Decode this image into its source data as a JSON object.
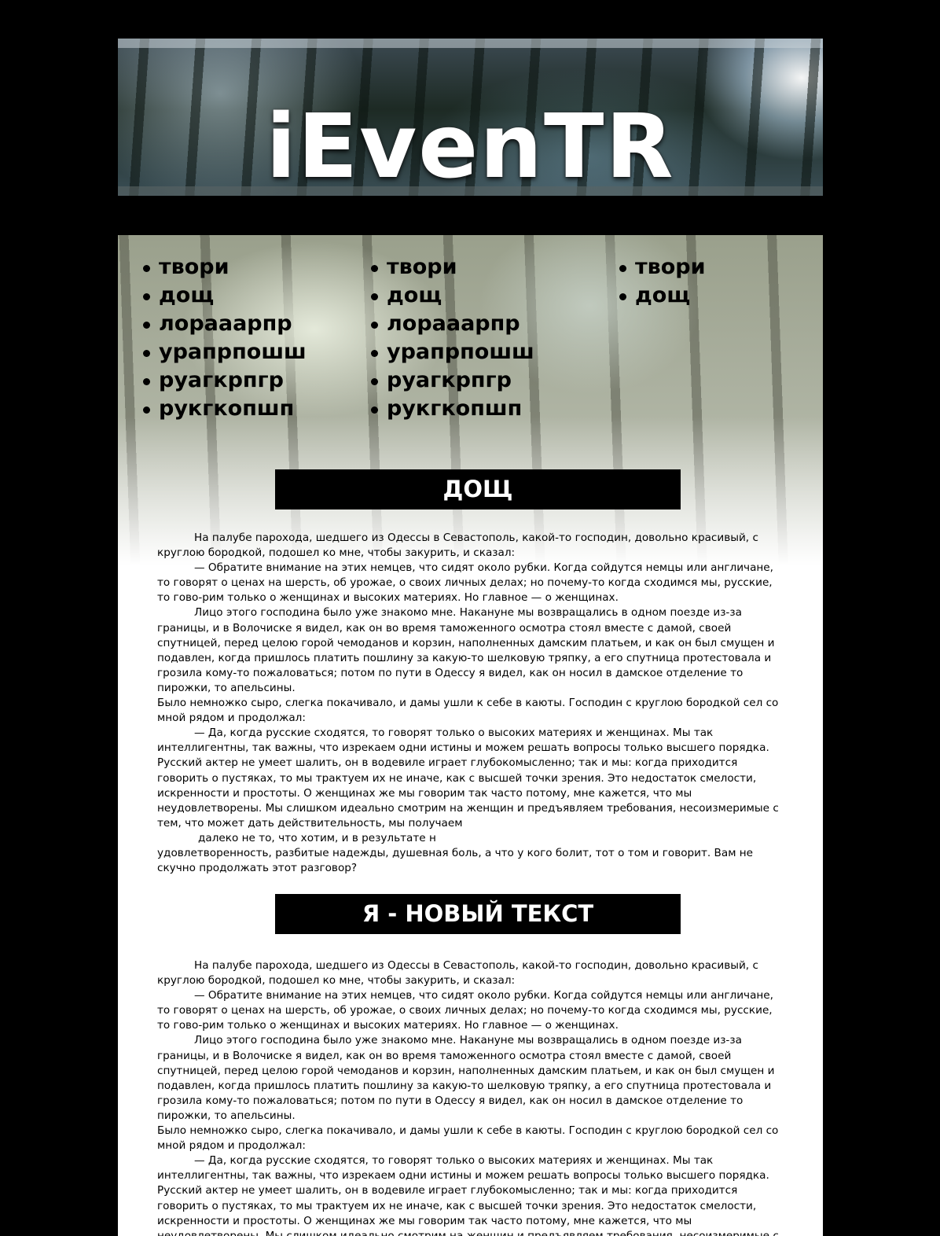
{
  "site": {
    "logo_text": "iEvenTR"
  },
  "menu": {
    "columns": [
      [
        "твори",
        "дощ",
        "лорааарпр",
        "урапрпошш",
        "руагкрпгр",
        "рукгкопшп"
      ],
      [
        "твори",
        "дощ",
        "лорааарпр",
        "урапрпошш",
        "руагкрпгр",
        "рукгкопшп"
      ],
      [
        "твори",
        "дощ"
      ]
    ]
  },
  "sections": [
    {
      "heading": "ДОЩ",
      "paragraphs": [
        "На палубе парохода, шедшего из Одессы в Севастополь, какой-то господин, довольно красивый, с круглою бородкой, подошел ко мне, чтобы закурить, и сказал:",
        "— Обратите внимание на этих немцев, что сидят около рубки. Когда сойдутся немцы или англичане, то говорят о ценах на шерсть, об урожае, о своих личных делах; но почему-то когда сходимся мы, русские, то гово-рим только о женщинах и высоких материях. Но главное — о женщинах.",
        "Лицо этого господина было уже знакомо мне. Накануне мы возвращались в одном поезде из-за границы, и в Волочиске я видел, как он во время таможенного осмотра стоял вместе с дамой, своей спутницей, перед целою горой чемоданов и корзин, наполненных дамским платьем, и как он был смущен и подавлен, когда пришлось платить пошлину за какую-то шелковую тряпку, а его спутница протестовала и грозила кому-то пожаловаться; потом по пути в Одессу я видел, как он носил в дамское отделение то пирожки, то апельсины.",
        "Было немножко сыро, слегка покачивало, и дамы ушли к себе в каюты. Господин с круглою бородкой сел со мной рядом и продолжал:",
        "— Да, когда русские сходятся, то говорят только о высоких материях и женщинах. Мы так интеллигентны, так важны, что изрекаем одни истины и можем решать вопросы только высшего порядка. Русский актер не умеет шалить, он в водевиле играет глубокомысленно; так и мы: когда приходится говорить о пустяках, то мы трактуем их не иначе, как с высшей точки зрения. Это недостаток смелости, искренности и простоты. О женщинах же мы говорим так часто потому, мне кажется, что мы неудовлетворены. Мы слишком идеально смотрим на женщин и предъявляем требования, несоизмеримые с тем, что может дать действительность, мы получаем",
        "далеко не то, что хотим, и в результате н",
        "удовлетворенность, разбитые надежды, душевная боль, а что у кого болит, тот о том и говорит. Вам не скучно продолжать этот разговор?"
      ]
    },
    {
      "heading": "Я - НОВЫЙ ТЕКСТ",
      "paragraphs": [
        "На палубе парохода, шедшего из Одессы в Севастополь, какой-то господин, довольно красивый, с круглою бородкой, подошел ко мне, чтобы закурить, и сказал:",
        "— Обратите внимание на этих немцев, что сидят около рубки. Когда сойдутся немцы или англичане, то говорят о ценах на шерсть, об урожае, о своих личных делах; но почему-то когда сходимся мы, русские, то гово-рим только о женщинах и высоких материях. Но главное — о женщинах.",
        "Лицо этого господина было уже знакомо мне. Накануне мы возвращались в одном поезде из-за границы, и в Волочиске я видел, как он во время таможенного осмотра стоял вместе с дамой, своей спутницей, перед целою горой чемоданов и корзин, наполненных дамским платьем, и как он был смущен и подавлен, когда пришлось платить пошлину за какую-то шелковую тряпку, а его спутница протестовала и грозила кому-то пожаловаться; потом по пути в Одессу я видел, как он носил в дамское отделение то пирожки, то апельсины.",
        "Было немножко сыро, слегка покачивало, и дамы ушли к себе в каюты. Господин с круглою бородкой сел со мной рядом и продолжал:",
        "— Да, когда русские сходятся, то говорят только о высоких материях и женщинах. Мы так интеллигентны, так важны, что изрекаем одни истины и можем решать вопросы только высшего порядка. Русский актер не умеет шалить, он в водевиле играет глубокомысленно; так и мы: когда приходится говорить о пустяках, то мы трактуем их не иначе, как с высшей точки зрения. Это недостаток смелости, искренности и простоты. О женщинах же мы говорим так часто потому, мне кажется, что мы неудовлетворены. Мы слишком идеально смотрим на женщин и предъявляем требования, несоизмеримые с тем, что может дать действительность, мы получаем"
      ]
    }
  ]
}
